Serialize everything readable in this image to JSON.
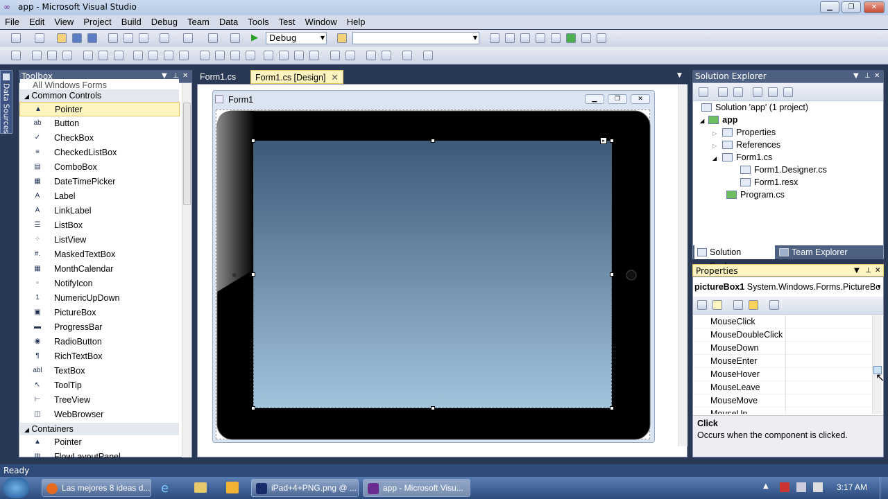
{
  "window": {
    "title": "app - Microsoft Visual Studio"
  },
  "menu": [
    "File",
    "Edit",
    "View",
    "Project",
    "Build",
    "Debug",
    "Team",
    "Data",
    "Tools",
    "Test",
    "Window",
    "Help"
  ],
  "toolbar": {
    "config": "Debug",
    "platform": ""
  },
  "side_tab": "Data Sources",
  "toolbox": {
    "title": "Toolbox",
    "top_group": "All Windows Forms",
    "group1": "Common Controls",
    "items": [
      {
        "label": "Pointer",
        "icon": "▲"
      },
      {
        "label": "Button",
        "icon": "ab"
      },
      {
        "label": "CheckBox",
        "icon": "✓"
      },
      {
        "label": "CheckedListBox",
        "icon": "≡"
      },
      {
        "label": "ComboBox",
        "icon": "▤"
      },
      {
        "label": "DateTimePicker",
        "icon": "▦"
      },
      {
        "label": "Label",
        "icon": "A"
      },
      {
        "label": "LinkLabel",
        "icon": "A"
      },
      {
        "label": "ListBox",
        "icon": "☰"
      },
      {
        "label": "ListView",
        "icon": "⁘"
      },
      {
        "label": "MaskedTextBox",
        "icon": "#."
      },
      {
        "label": "MonthCalendar",
        "icon": "▦"
      },
      {
        "label": "NotifyIcon",
        "icon": "▫"
      },
      {
        "label": "NumericUpDown",
        "icon": "1"
      },
      {
        "label": "PictureBox",
        "icon": "▣"
      },
      {
        "label": "ProgressBar",
        "icon": "▬"
      },
      {
        "label": "RadioButton",
        "icon": "◉"
      },
      {
        "label": "RichTextBox",
        "icon": "¶"
      },
      {
        "label": "TextBox",
        "icon": "abl"
      },
      {
        "label": "ToolTip",
        "icon": "↖"
      },
      {
        "label": "TreeView",
        "icon": "⊢"
      },
      {
        "label": "WebBrowser",
        "icon": "◫"
      }
    ],
    "group2": "Containers",
    "items2": [
      {
        "label": "Pointer",
        "icon": "▲"
      },
      {
        "label": "FlowLayoutPanel",
        "icon": "▥"
      }
    ]
  },
  "tabs": [
    {
      "label": "Form1.cs"
    },
    {
      "label": "Form1.cs [Design]"
    }
  ],
  "form": {
    "title": "Form1"
  },
  "solution_explorer": {
    "title": "Solution Explorer",
    "nodes": [
      {
        "label": "Solution 'app' (1 project)"
      },
      {
        "label": "app"
      },
      {
        "label": "Properties"
      },
      {
        "label": "References"
      },
      {
        "label": "Form1.cs"
      },
      {
        "label": "Form1.Designer.cs"
      },
      {
        "label": "Form1.resx"
      },
      {
        "label": "Program.cs"
      }
    ],
    "bottom_tabs": [
      "Solution Explorer",
      "Team Explorer"
    ]
  },
  "properties": {
    "title": "Properties",
    "object_name": "pictureBox1",
    "object_type": "System.Windows.Forms.PictureBo",
    "rows": [
      "MouseClick",
      "MouseDoubleClick",
      "MouseDown",
      "MouseEnter",
      "MouseHover",
      "MouseLeave",
      "MouseMove",
      "MouseUp"
    ],
    "desc_title": "Click",
    "desc_text": "Occurs when the component is clicked."
  },
  "status": {
    "text": "Ready"
  },
  "taskbar": {
    "items": [
      {
        "label": "Las mejores 8 ideas d..."
      },
      {
        "label": "iPad+4+PNG.png @ ..."
      },
      {
        "label": "app - Microsoft Visu..."
      }
    ],
    "clock": "3:17 AM"
  },
  "colors": {
    "accent": "#4d6082",
    "selected": "#fdf4bf",
    "panel_bg": "#293955"
  }
}
